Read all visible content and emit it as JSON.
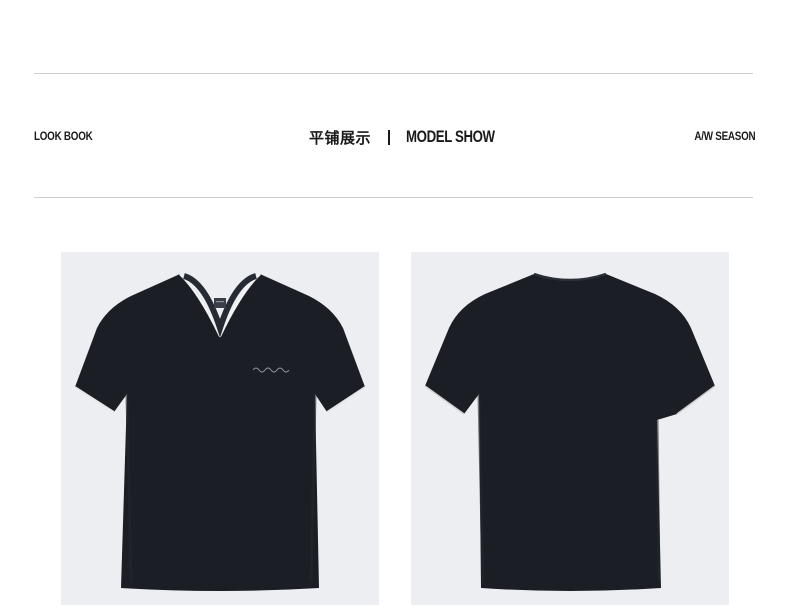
{
  "header": {
    "left_label": "LOOK BOOK",
    "center_title_cn": "平铺展示",
    "center_title_en": "MODEL SHOW",
    "right_label": "A/W SEASON"
  },
  "colors": {
    "shirt": "#1b1e25",
    "photo_background": "#eceef2",
    "rule": "#cfcfcf"
  },
  "photos": [
    {
      "name": "front-view",
      "style": "v-neck t-shirt front, white piping at collar and sleeve edges, small chest logo"
    },
    {
      "name": "back-view",
      "style": "t-shirt back"
    }
  ]
}
